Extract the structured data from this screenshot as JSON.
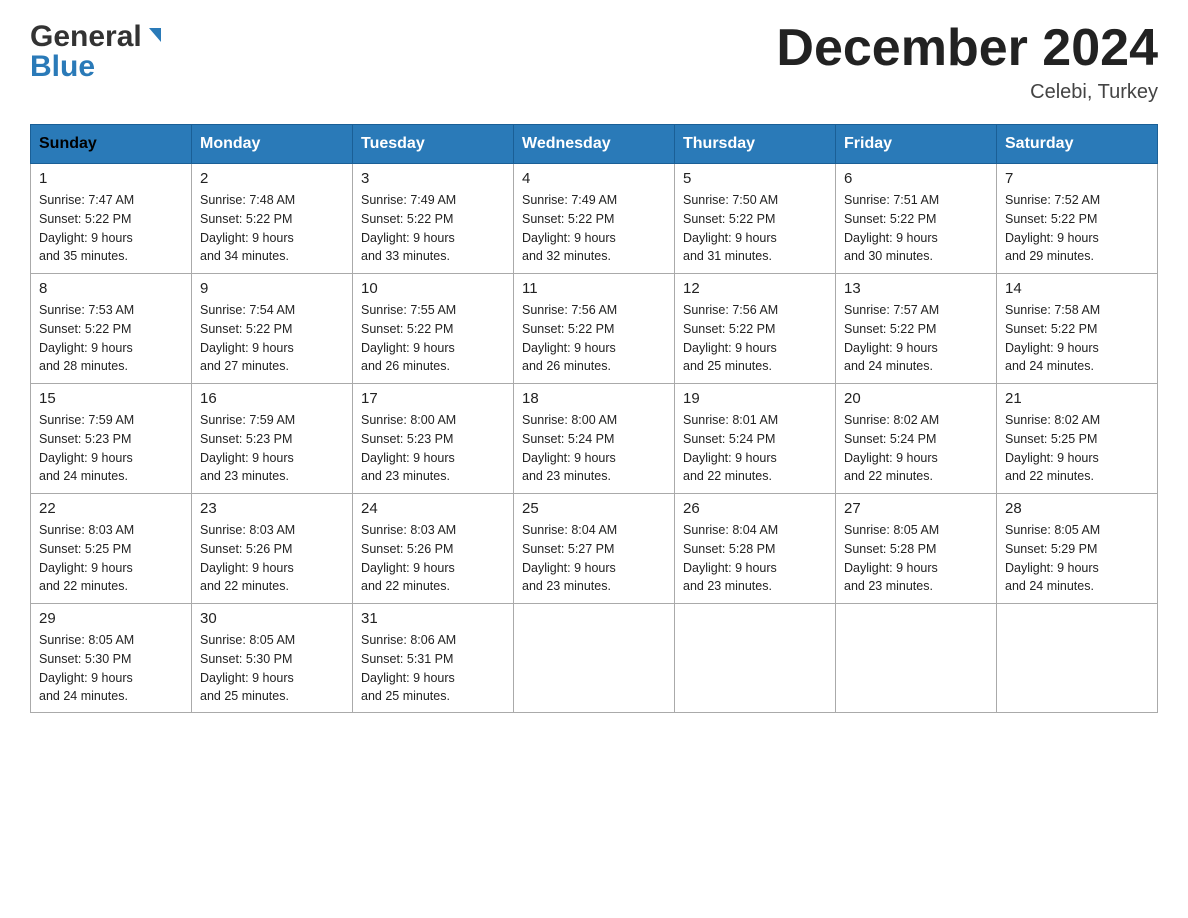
{
  "header": {
    "logo_line1": "General",
    "logo_line2": "Blue",
    "month_title": "December 2024",
    "location": "Celebi, Turkey"
  },
  "days_of_week": [
    "Sunday",
    "Monday",
    "Tuesday",
    "Wednesday",
    "Thursday",
    "Friday",
    "Saturday"
  ],
  "weeks": [
    [
      {
        "day": "1",
        "sunrise": "7:47 AM",
        "sunset": "5:22 PM",
        "daylight": "9 hours and 35 minutes."
      },
      {
        "day": "2",
        "sunrise": "7:48 AM",
        "sunset": "5:22 PM",
        "daylight": "9 hours and 34 minutes."
      },
      {
        "day": "3",
        "sunrise": "7:49 AM",
        "sunset": "5:22 PM",
        "daylight": "9 hours and 33 minutes."
      },
      {
        "day": "4",
        "sunrise": "7:49 AM",
        "sunset": "5:22 PM",
        "daylight": "9 hours and 32 minutes."
      },
      {
        "day": "5",
        "sunrise": "7:50 AM",
        "sunset": "5:22 PM",
        "daylight": "9 hours and 31 minutes."
      },
      {
        "day": "6",
        "sunrise": "7:51 AM",
        "sunset": "5:22 PM",
        "daylight": "9 hours and 30 minutes."
      },
      {
        "day": "7",
        "sunrise": "7:52 AM",
        "sunset": "5:22 PM",
        "daylight": "9 hours and 29 minutes."
      }
    ],
    [
      {
        "day": "8",
        "sunrise": "7:53 AM",
        "sunset": "5:22 PM",
        "daylight": "9 hours and 28 minutes."
      },
      {
        "day": "9",
        "sunrise": "7:54 AM",
        "sunset": "5:22 PM",
        "daylight": "9 hours and 27 minutes."
      },
      {
        "day": "10",
        "sunrise": "7:55 AM",
        "sunset": "5:22 PM",
        "daylight": "9 hours and 26 minutes."
      },
      {
        "day": "11",
        "sunrise": "7:56 AM",
        "sunset": "5:22 PM",
        "daylight": "9 hours and 26 minutes."
      },
      {
        "day": "12",
        "sunrise": "7:56 AM",
        "sunset": "5:22 PM",
        "daylight": "9 hours and 25 minutes."
      },
      {
        "day": "13",
        "sunrise": "7:57 AM",
        "sunset": "5:22 PM",
        "daylight": "9 hours and 24 minutes."
      },
      {
        "day": "14",
        "sunrise": "7:58 AM",
        "sunset": "5:22 PM",
        "daylight": "9 hours and 24 minutes."
      }
    ],
    [
      {
        "day": "15",
        "sunrise": "7:59 AM",
        "sunset": "5:23 PM",
        "daylight": "9 hours and 24 minutes."
      },
      {
        "day": "16",
        "sunrise": "7:59 AM",
        "sunset": "5:23 PM",
        "daylight": "9 hours and 23 minutes."
      },
      {
        "day": "17",
        "sunrise": "8:00 AM",
        "sunset": "5:23 PM",
        "daylight": "9 hours and 23 minutes."
      },
      {
        "day": "18",
        "sunrise": "8:00 AM",
        "sunset": "5:24 PM",
        "daylight": "9 hours and 23 minutes."
      },
      {
        "day": "19",
        "sunrise": "8:01 AM",
        "sunset": "5:24 PM",
        "daylight": "9 hours and 22 minutes."
      },
      {
        "day": "20",
        "sunrise": "8:02 AM",
        "sunset": "5:24 PM",
        "daylight": "9 hours and 22 minutes."
      },
      {
        "day": "21",
        "sunrise": "8:02 AM",
        "sunset": "5:25 PM",
        "daylight": "9 hours and 22 minutes."
      }
    ],
    [
      {
        "day": "22",
        "sunrise": "8:03 AM",
        "sunset": "5:25 PM",
        "daylight": "9 hours and 22 minutes."
      },
      {
        "day": "23",
        "sunrise": "8:03 AM",
        "sunset": "5:26 PM",
        "daylight": "9 hours and 22 minutes."
      },
      {
        "day": "24",
        "sunrise": "8:03 AM",
        "sunset": "5:26 PM",
        "daylight": "9 hours and 22 minutes."
      },
      {
        "day": "25",
        "sunrise": "8:04 AM",
        "sunset": "5:27 PM",
        "daylight": "9 hours and 23 minutes."
      },
      {
        "day": "26",
        "sunrise": "8:04 AM",
        "sunset": "5:28 PM",
        "daylight": "9 hours and 23 minutes."
      },
      {
        "day": "27",
        "sunrise": "8:05 AM",
        "sunset": "5:28 PM",
        "daylight": "9 hours and 23 minutes."
      },
      {
        "day": "28",
        "sunrise": "8:05 AM",
        "sunset": "5:29 PM",
        "daylight": "9 hours and 24 minutes."
      }
    ],
    [
      {
        "day": "29",
        "sunrise": "8:05 AM",
        "sunset": "5:30 PM",
        "daylight": "9 hours and 24 minutes."
      },
      {
        "day": "30",
        "sunrise": "8:05 AM",
        "sunset": "5:30 PM",
        "daylight": "9 hours and 25 minutes."
      },
      {
        "day": "31",
        "sunrise": "8:06 AM",
        "sunset": "5:31 PM",
        "daylight": "9 hours and 25 minutes."
      },
      null,
      null,
      null,
      null
    ]
  ],
  "labels": {
    "sunrise": "Sunrise:",
    "sunset": "Sunset:",
    "daylight": "Daylight:"
  }
}
